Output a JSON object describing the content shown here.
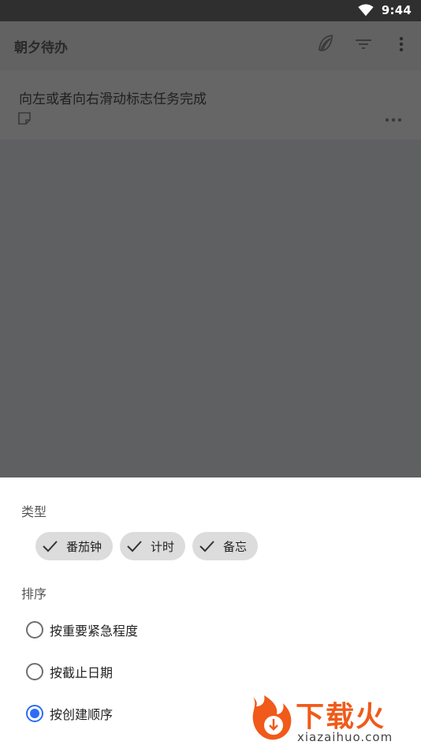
{
  "status_bar": {
    "time": "9:44",
    "wifi_icon": "wifi-icon"
  },
  "app_bar": {
    "title": "朝夕待办",
    "icons": [
      "feather-icon",
      "filter-icon",
      "more-vertical-icon"
    ]
  },
  "task": {
    "title": "向左或者向右滑动标志任务完成",
    "icons": [
      "note-icon",
      "more-horizontal-icon"
    ]
  },
  "sheet": {
    "type_label": "类型",
    "chips": [
      {
        "label": "番茄钟",
        "checked": true
      },
      {
        "label": "计时",
        "checked": true
      },
      {
        "label": "备忘",
        "checked": true
      }
    ],
    "sort_label": "排序",
    "sort_options": [
      {
        "label": "按重要紧急程度",
        "selected": false
      },
      {
        "label": "按截止日期",
        "selected": false
      },
      {
        "label": "按创建顺序",
        "selected": true
      }
    ]
  },
  "watermark": {
    "text": "下载火",
    "sub": "xiazaihuo.com"
  },
  "colors": {
    "accent": "#2d6cf6",
    "chip_bg": "#dcdcdc",
    "scrim": "#5f6062"
  }
}
